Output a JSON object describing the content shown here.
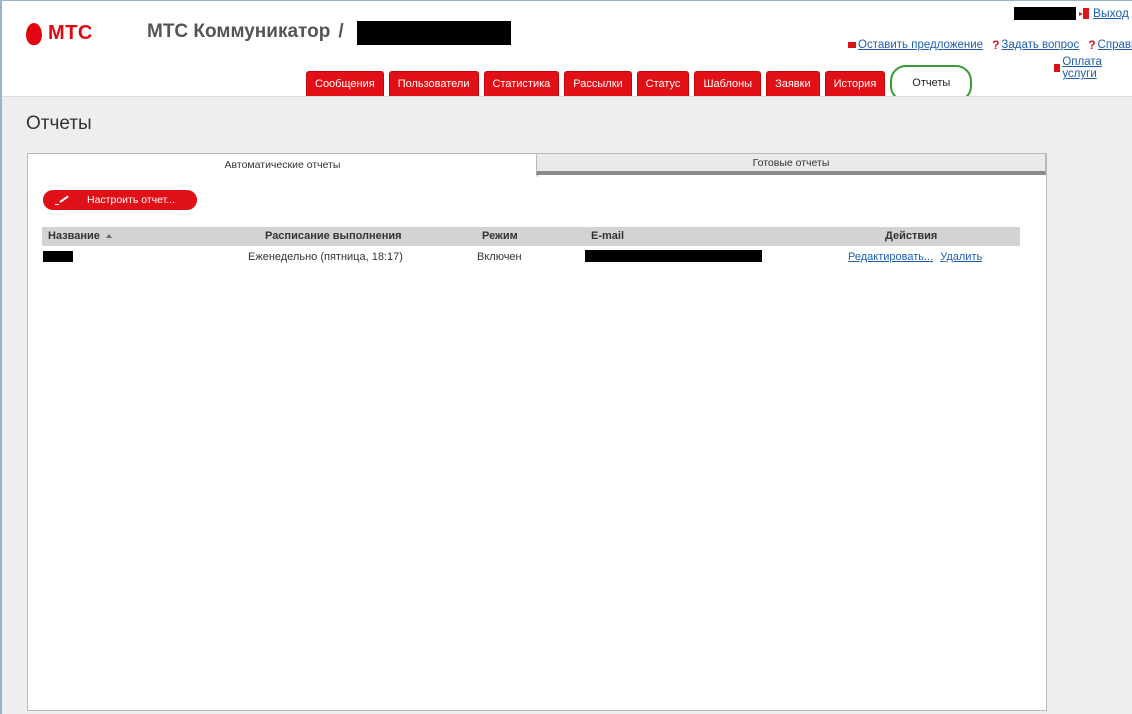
{
  "header": {
    "logo_text": "МТС",
    "app_title": "МТС Коммуникатор",
    "title_separator": "/",
    "exit_label": "Выход",
    "links": {
      "suggest": "Оставить предложение",
      "ask": "Задать вопрос",
      "help": "Справка",
      "pay": "Оплата услуги"
    }
  },
  "nav": {
    "tabs": [
      {
        "label": "Сообщения"
      },
      {
        "label": "Пользователи"
      },
      {
        "label": "Статистика"
      },
      {
        "label": "Рассылки"
      },
      {
        "label": "Статус"
      },
      {
        "label": "Шаблоны"
      },
      {
        "label": "Заявки"
      },
      {
        "label": "История"
      },
      {
        "label": "Отчеты"
      }
    ],
    "active_tab": "Отчеты"
  },
  "page": {
    "title": "Отчеты",
    "panel_tabs": {
      "auto": "Автоматические отчеты",
      "ready": "Готовые отчеты"
    },
    "configure_button": "Настроить отчет..."
  },
  "table": {
    "columns": {
      "name": "Название",
      "schedule": "Расписание выполнения",
      "mode": "Режим",
      "email": "E-mail",
      "actions": "Действия"
    },
    "rows": [
      {
        "schedule": "Еженедельно (пятница, 18:17)",
        "mode": "Включен",
        "edit": "Редактировать...",
        "delete": "Удалить"
      }
    ]
  },
  "colors": {
    "brand_red": "#e30611",
    "active_tab_outline": "#3a9a3a",
    "link": "#1f5ea9"
  }
}
